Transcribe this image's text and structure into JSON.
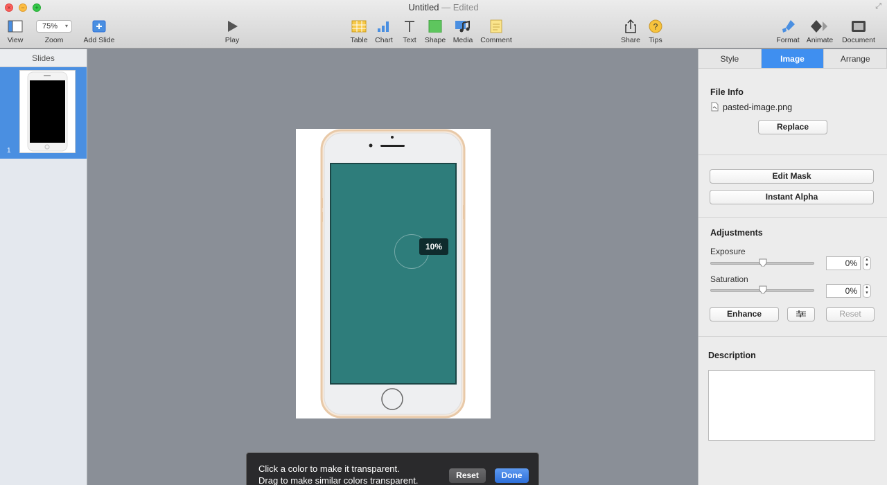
{
  "window": {
    "title": "Untitled",
    "title_sep": " — ",
    "status": "Edited"
  },
  "toolbar": {
    "view": "View",
    "zoom_value": "75%",
    "zoom": "Zoom",
    "add_slide": "Add Slide",
    "play": "Play",
    "table": "Table",
    "chart": "Chart",
    "text": "Text",
    "shape": "Shape",
    "media": "Media",
    "comment": "Comment",
    "share": "Share",
    "tips": "Tips",
    "format": "Format",
    "animate": "Animate",
    "document": "Document"
  },
  "slides_panel": {
    "header": "Slides",
    "slide_number": "1"
  },
  "canvas": {
    "zoom_badge": "10%"
  },
  "hud": {
    "line1": "Click a color to make it transparent.",
    "line2": "Drag to make similar colors transparent.",
    "reset": "Reset",
    "done": "Done"
  },
  "inspector": {
    "tabs": [
      "Style",
      "Image",
      "Arrange"
    ],
    "file_info": {
      "title": "File Info",
      "filename": "pasted-image.png",
      "replace": "Replace"
    },
    "mask": {
      "edit_mask": "Edit Mask",
      "instant_alpha": "Instant Alpha"
    },
    "adjustments": {
      "title": "Adjustments",
      "exposure_label": "Exposure",
      "exposure_value": "0%",
      "saturation_label": "Saturation",
      "saturation_value": "0%",
      "enhance": "Enhance",
      "reset": "Reset"
    },
    "description": {
      "title": "Description"
    }
  },
  "colors": {
    "accent": "#3f8ff0",
    "screen_teal": "#2e7d7b",
    "phone_gold": "#e8c9a8"
  }
}
